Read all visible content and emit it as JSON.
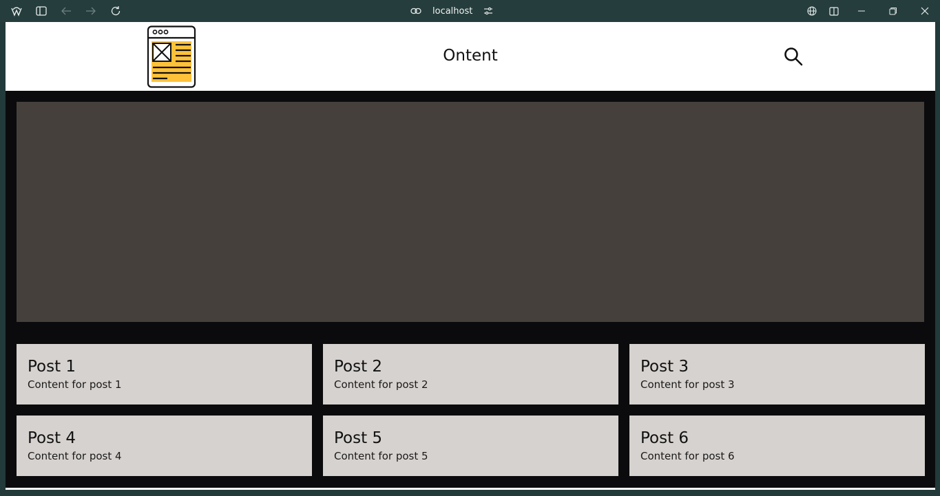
{
  "browser": {
    "address": "localhost",
    "icons": [
      "app-logo-icon",
      "sidebar-toggle-icon",
      "back-arrow-icon",
      "forward-arrow-icon",
      "reload-icon",
      "link-icon",
      "site-settings-icon",
      "globe-icon",
      "split-view-icon",
      "minimize-icon",
      "restore-icon",
      "close-icon"
    ]
  },
  "header": {
    "title": "Ontent",
    "logo_icon": "news-article-icon",
    "search_icon": "search-icon",
    "accent": "#fec23a"
  },
  "hero": {
    "color": "#45403c"
  },
  "posts": [
    {
      "title": "Post 1",
      "content": "Content for post 1"
    },
    {
      "title": "Post 2",
      "content": "Content for post 2"
    },
    {
      "title": "Post 3",
      "content": "Content for post 3"
    },
    {
      "title": "Post 4",
      "content": "Content for post 4"
    },
    {
      "title": "Post 5",
      "content": "Content for post 5"
    },
    {
      "title": "Post 6",
      "content": "Content for post 6"
    }
  ]
}
